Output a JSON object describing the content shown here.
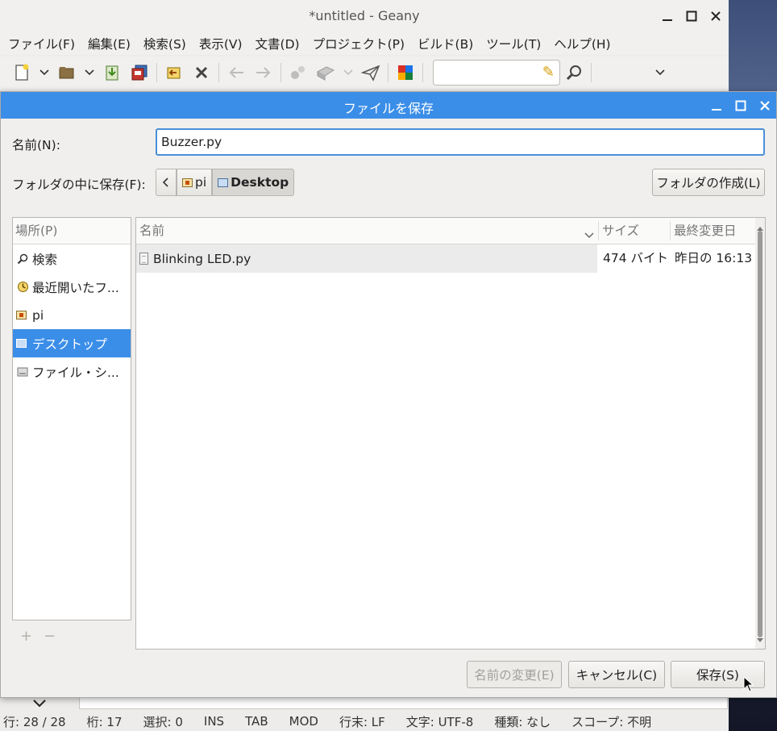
{
  "geany": {
    "title": "*untitled - Geany",
    "menu": [
      "ファイル(F)",
      "編集(E)",
      "検索(S)",
      "表示(V)",
      "文書(D)",
      "プロジェクト(P)",
      "ビルド(B)",
      "ツール(T)",
      "ヘルプ(H)"
    ],
    "status": {
      "line": "行: 28 / 28",
      "col": "桁: 17",
      "sel": "選択: 0",
      "ins": "INS",
      "tab": "TAB",
      "mod": "MOD",
      "eol": "行末: LF",
      "enc": "文字: UTF-8",
      "type": "種類: なし",
      "scope": "スコープ: 不明"
    }
  },
  "dialog": {
    "title": "ファイルを保存",
    "name_label": "名前(N):",
    "name_value": "Buzzer.py",
    "folder_label": "フォルダの中に保存(F):",
    "path": [
      "pi",
      "Desktop"
    ],
    "create_folder": "フォルダの作成(L)",
    "places_header": "場所(P)",
    "places": [
      {
        "icon": "search-icon",
        "glyph": "⚲",
        "label": "検索"
      },
      {
        "icon": "recent-icon",
        "glyph": "◔",
        "label": "最近開いたフ..."
      },
      {
        "icon": "home-folder-icon",
        "glyph": "",
        "label": "pi"
      },
      {
        "icon": "desktop-folder-icon",
        "glyph": "",
        "label": "デスクトップ"
      },
      {
        "icon": "drive-icon",
        "glyph": "▣",
        "label": "ファイル・シ..."
      }
    ],
    "columns": {
      "name": "名前",
      "size": "サイズ",
      "modified": "最終変更日"
    },
    "files": [
      {
        "name": "Blinking LED.py",
        "size": "474 バイト",
        "modified": "昨日の 16:13"
      }
    ],
    "buttons": {
      "rename": "名前の変更(E)",
      "cancel": "キャンセル(C)",
      "save": "保存(S)"
    }
  }
}
